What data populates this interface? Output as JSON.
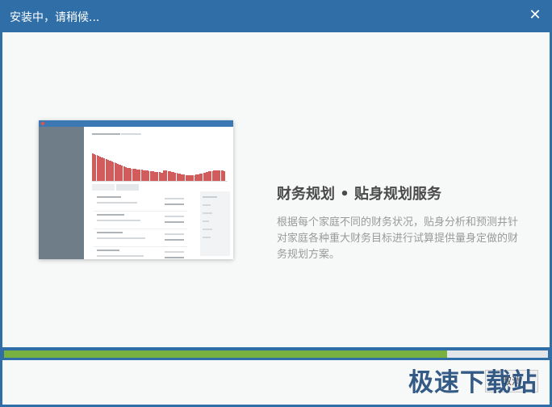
{
  "window": {
    "title": "安装中，请稍候...",
    "close_icon": "close-icon"
  },
  "slide": {
    "headline": "财务规划 • 贴身规划服务",
    "description": "根据每个家庭不同的财务状况，贴身分析和预测井针对家庭各种重大财务目标进行试算提供量身定做的财务规划方案。"
  },
  "progress": {
    "fraction": 0.815
  },
  "footer": {
    "button_label": "取消",
    "watermark": "极速下载站"
  },
  "colors": {
    "titlebar": "#2f6ea6",
    "progress": "#78b13f"
  }
}
